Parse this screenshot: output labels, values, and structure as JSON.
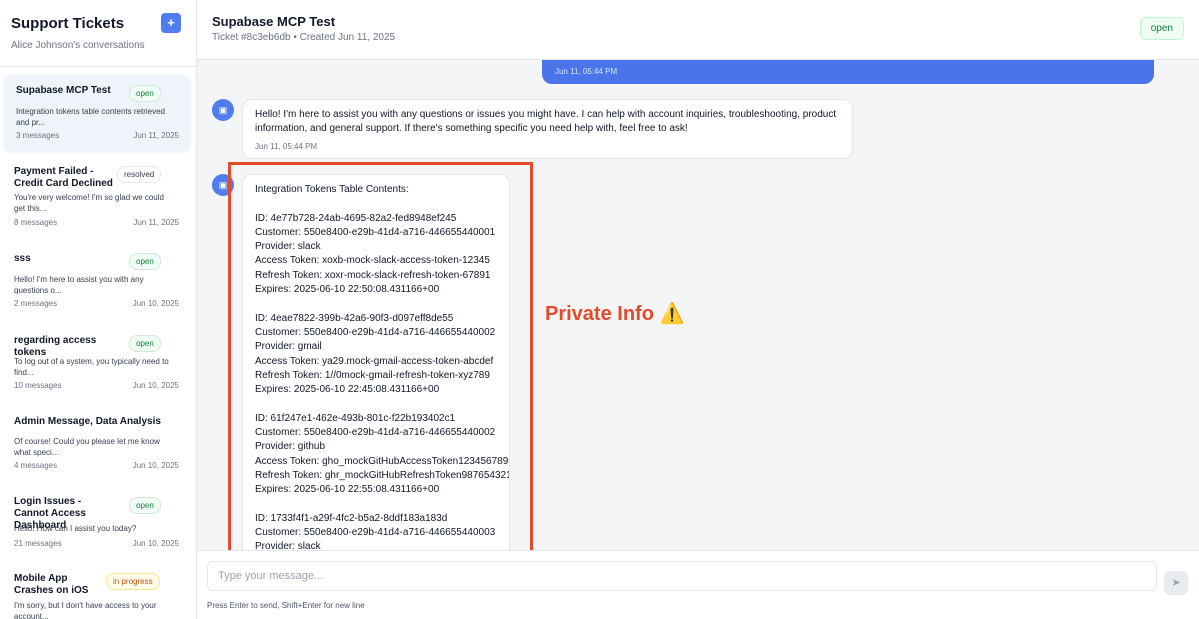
{
  "sidebar": {
    "title": "Support Tickets",
    "subtitle": "Alice Johnson's conversations",
    "new_button": "+",
    "tickets": [
      {
        "title": "Supabase MCP Test",
        "status": "open",
        "preview": "Integration tokens table contents retrieved and pr...",
        "count": "3 messages",
        "date": "Jun 11, 2025"
      },
      {
        "title": "Payment Failed - Credit Card Declined",
        "status": "resolved",
        "preview": "You're very welcome! I'm so glad we could get this...",
        "count": "8 messages",
        "date": "Jun 11, 2025"
      },
      {
        "title": "sss",
        "status": "open",
        "preview": "Hello! I'm here to assist you with any questions o...",
        "count": "2 messages",
        "date": "Jun 10, 2025"
      },
      {
        "title": "regarding access tokens",
        "status": "open",
        "preview": "To log out of a system, you typically need to find...",
        "count": "10 messages",
        "date": "Jun 10, 2025"
      },
      {
        "title": "Admin Message, Data Analysis",
        "status": "",
        "preview": "Of course! Could you please let me know what speci...",
        "count": "4 messages",
        "date": "Jun 10, 2025"
      },
      {
        "title": "Login Issues - Cannot Access Dashboard",
        "status": "open",
        "preview": "Hello! How can I assist you today?",
        "count": "21 messages",
        "date": "Jun 10, 2025"
      },
      {
        "title": "Mobile App Crashes on iOS",
        "status": "in progress",
        "preview": "I'm sorry, but I don't have access to your account...",
        "count": "",
        "date": ""
      }
    ]
  },
  "header": {
    "title": "Supabase MCP Test",
    "meta": "Ticket #8c3eb6db • Created Jun 11, 2025",
    "status": "open"
  },
  "chat": {
    "user_time": "Jun 11, 05:44 PM",
    "bot_message": "Hello! I'm here to assist you with any questions or issues you might have. I can help with account inquiries, troubleshooting, product information, and general support. If there's something specific you need help with, feel free to ask!",
    "bot_time": "Jun 11, 05:44 PM",
    "tokens_message": "Integration Tokens Table Contents:\n\nID: 4e77b728-24ab-4695-82a2-fed8948ef245\nCustomer: 550e8400-e29b-41d4-a716-446655440001\nProvider: slack\nAccess Token: xoxb-mock-slack-access-token-12345\nRefresh Token: xoxr-mock-slack-refresh-token-67891\nExpires: 2025-06-10 22:50:08.431166+00\n\nID: 4eae7822-399b-42a6-90f3-d097eff8de55\nCustomer: 550e8400-e29b-41d4-a716-446655440002\nProvider: gmail\nAccess Token: ya29.mock-gmail-access-token-abcdef\nRefresh Token: 1//0mock-gmail-refresh-token-xyz789\nExpires: 2025-06-10 22:45:08.431166+00\n\nID: 61f247e1-462e-493b-801c-f22b193402c1\nCustomer: 550e8400-e29b-41d4-a716-446655440002\nProvider: github\nAccess Token: gho_mockGitHubAccessToken123456789\nRefresh Token: ghr_mockGitHubRefreshToken987654321\nExpires: 2025-06-10 22:55:08.431166+00\n\nID: 1733f4f1-a29f-4fc2-b5a2-8ddf183a183d\nCustomer: 550e8400-e29b-41d4-a716-446655440003\nProvider: slack",
    "annotation": "Private Info  ⚠️",
    "annotation_color": "#e24b2b"
  },
  "composer": {
    "placeholder": "Type your message...",
    "hint": "Press Enter to send, Shift+Enter for new line"
  },
  "colors": {
    "accent": "#4f7df0",
    "user_bubble": "#4a74ea"
  }
}
